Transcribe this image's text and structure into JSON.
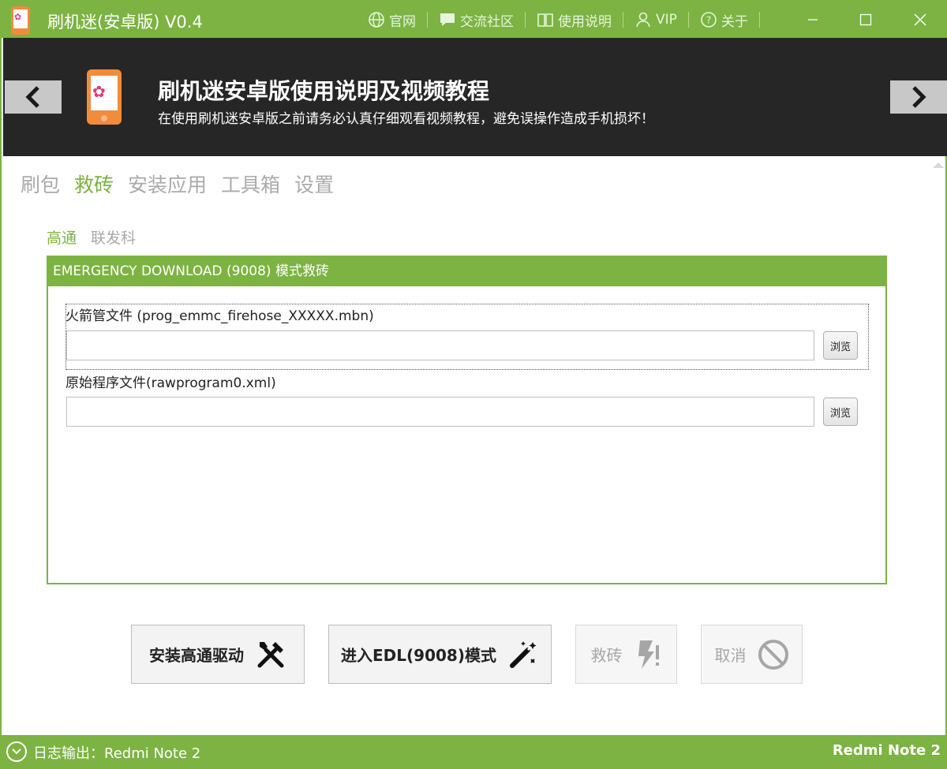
{
  "app": {
    "title": "刷机迷(安卓版) V0.4",
    "accent_color": "#7cb342",
    "icon": "app-phone-icon"
  },
  "titlebar_menu": [
    {
      "label": "官网",
      "icon": "globe-icon"
    },
    {
      "label": "交流社区",
      "icon": "chat-icon"
    },
    {
      "label": "使用说明",
      "icon": "book-icon"
    },
    {
      "label": "VIP",
      "icon": "user-icon"
    },
    {
      "label": "关于",
      "icon": "help-icon"
    }
  ],
  "window_controls": [
    "minimize",
    "maximize",
    "close"
  ],
  "banner": {
    "title": "刷机迷安卓版使用说明及视频教程",
    "subtitle": "在使用刷机迷安卓版之前请务必认真仔细观看视频教程，避免误操作造成手机损坏！"
  },
  "main_tabs": {
    "items": [
      "刷包",
      "救砖",
      "安装应用",
      "工具箱",
      "设置"
    ],
    "active": "救砖"
  },
  "sub_tabs": {
    "items": [
      "高通",
      "联发科"
    ],
    "active": "高通"
  },
  "panel": {
    "header": "EMERGENCY DOWNLOAD   (9008)  模式救砖",
    "fields": [
      {
        "label": "火箭管文件 (prog_emmc_firehose_XXXXX.mbn)",
        "value": "",
        "browse_label": "浏览"
      },
      {
        "label": "原始程序文件(rawprogram0.xml)",
        "value": "",
        "browse_label": "浏览"
      }
    ]
  },
  "actions": [
    {
      "label": "安装高通驱动",
      "icon": "tools-icon",
      "enabled": true
    },
    {
      "label": "进入EDL(9008)模式",
      "icon": "magic-wand-icon",
      "enabled": true
    },
    {
      "label": "救砖",
      "icon": "flash-alert-icon",
      "enabled": false
    },
    {
      "label": "取消",
      "icon": "cancel-icon",
      "enabled": false
    }
  ],
  "statusbar": {
    "log_text": "日志输出：Redmi Note 2",
    "device": "Redmi Note 2"
  }
}
